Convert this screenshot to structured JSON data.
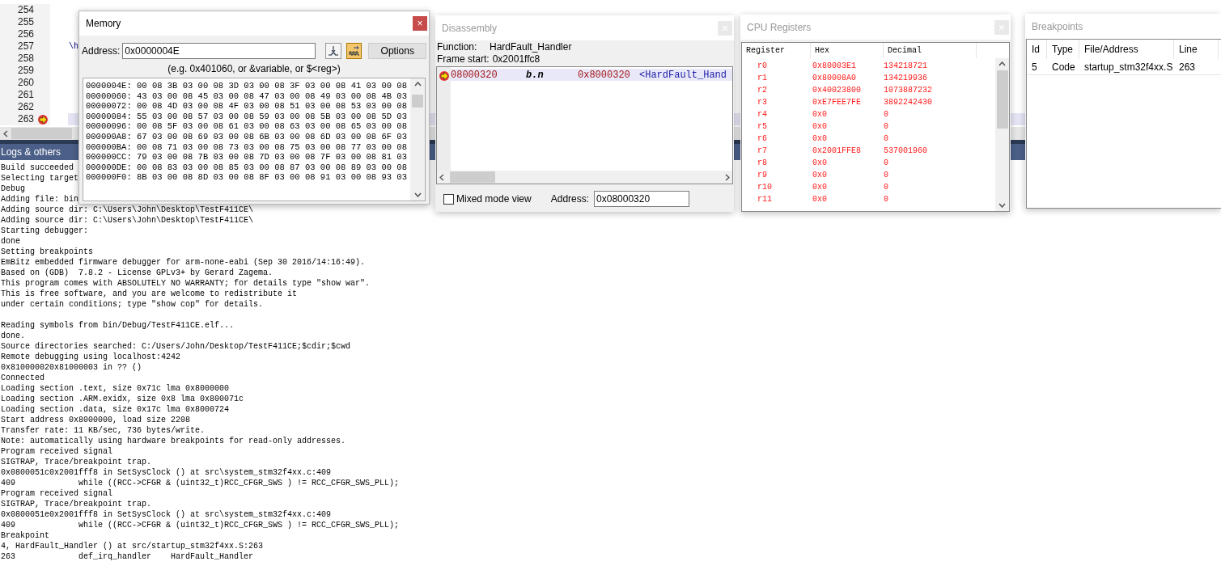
{
  "editor": {
    "lines": [
      {
        "number": "254",
        "current": false
      },
      {
        "number": "255",
        "current": false
      },
      {
        "number": "256",
        "current": false
      },
      {
        "number": "257",
        "code": "\\h",
        "current": false
      },
      {
        "number": "258",
        "current": false
      },
      {
        "number": "259",
        "current": false
      },
      {
        "number": "260",
        "current": false
      },
      {
        "number": "261",
        "current": false
      },
      {
        "number": "262",
        "current": false
      },
      {
        "number": "263",
        "current": true
      }
    ]
  },
  "logs": {
    "title": "Logs & others",
    "blocks": [
      [
        "Build succeeded",
        "Selecting target",
        "Debug",
        "Adding file: bin",
        "Adding source dir: C:\\Users\\John\\Desktop\\TestF411CE\\",
        "Adding source dir: C:\\Users\\John\\Desktop\\TestF411CE\\",
        "Starting debugger:",
        "done",
        "Setting breakpoints",
        "EmBitz embedded firmware debugger for arm-none-eabi (Sep 30 2016/14:16:49).",
        "Based on (GDB)  7.8.2 - License GPLv3+ by Gerard Zagema.",
        "This program comes with ABSOLUTELY NO WARRANTY; for details type \"show war\".",
        "This is free software, and you are welcome to redistribute it",
        "under certain conditions; type \"show cop\" for details."
      ],
      [
        "Reading symbols from bin/Debug/TestF411CE.elf...",
        "done.",
        "Source directories searched: C:/Users/John/Desktop/TestF411CE;$cdir;$cwd",
        "Remote debugging using localhost:4242",
        "0x810000020x81000003 in ?? ()",
        "Connected",
        "Loading section .text, size 0x71c lma 0x8000000",
        "Loading section .ARM.exidx, size 0x8 lma 0x800071c",
        "Loading section .data, size 0x17c lma 0x8000724",
        "Start address 0x8000000, load size 2208",
        "Transfer rate: 11 KB/sec, 736 bytes/write.",
        "Note: automatically using hardware breakpoints for read-only addresses.",
        "Program received signal",
        "SIGTRAP, Trace/breakpoint trap.",
        "0x0800051c0x2001fff8 in SetSysClock () at src\\system_stm32f4xx.c:409",
        "409\t        while ((RCC->CFGR & (uint32_t)RCC_CFGR_SWS ) != RCC_CFGR_SWS_PLL);",
        "Program received signal",
        "SIGTRAP, Trace/breakpoint trap.",
        "0x0800051e0x2001fff8 in SetSysClock () at src\\system_stm32f4xx.c:409",
        "409\t        while ((RCC->CFGR & (uint32_t)RCC_CFGR_SWS ) != RCC_CFGR_SWS_PLL);",
        "Breakpoint",
        "4, HardFault_Handler () at src/startup_stm32f4xx.S:263",
        "263\t        def_irq_handler    HardFault_Handler"
      ]
    ]
  },
  "memory": {
    "title": "Memory",
    "close": "×",
    "address_label": "Address:",
    "address_value": "0x0000004E",
    "options_button": "Options",
    "hint": "(e.g. 0x401060, or &variable, or $<reg>)",
    "rows": [
      "0000004E: 00 08 3B 03 00 08 3D 03 00 08 3F 03 00 08 41 03 00 08",
      "00000060: 43 03 00 08 45 03 00 08 47 03 00 08 49 03 00 08 4B 03",
      "00000072: 00 08 4D 03 00 08 4F 03 00 08 51 03 00 08 53 03 00 08",
      "00000084: 55 03 00 08 57 03 00 08 59 03 00 08 5B 03 00 08 5D 03",
      "00000096: 00 08 5F 03 00 08 61 03 00 08 63 03 00 08 65 03 00 08",
      "000000A8: 67 03 00 08 69 03 00 08 6B 03 00 08 6D 03 00 08 6F 03",
      "000000BA: 00 08 71 03 00 08 73 03 00 08 75 03 00 08 77 03 00 08",
      "000000CC: 79 03 00 08 7B 03 00 08 7D 03 00 08 7F 03 00 08 81 03",
      "000000DE: 00 08 83 03 00 08 85 03 00 08 87 03 00 08 89 03 00 08",
      "000000F0: 8B 03 00 08 8D 03 00 08 8F 03 00 08 91 03 00 08 93 03"
    ]
  },
  "disassembly": {
    "title": "Disassembly",
    "function_label": "Function:",
    "function_value": "HardFault_Handler",
    "frame_label": "Frame start:",
    "frame_value": "0x2001ffc8",
    "rows": [
      {
        "address": "08000320",
        "mnemonic": "b.n",
        "operand": "0x8000320",
        "symbol": "<HardFault_Hand",
        "current": true
      }
    ],
    "mixed_mode": {
      "label": "Mixed mode view",
      "checked": false
    },
    "address_label": "Address:",
    "address_value": "0x08000320"
  },
  "registers": {
    "title": "CPU Registers",
    "columns": [
      "Register",
      "Hex",
      "Decimal"
    ],
    "rows": [
      {
        "name": "r0",
        "hex": "0x80003E1",
        "decimal": "134218721",
        "changed": true
      },
      {
        "name": "r1",
        "hex": "0x80008A0",
        "decimal": "134219936",
        "changed": true
      },
      {
        "name": "r2",
        "hex": "0x40023800",
        "decimal": "1073887232",
        "changed": true
      },
      {
        "name": "r3",
        "hex": "0xE7FEE7FE",
        "decimal": "3892242430",
        "changed": true
      },
      {
        "name": "r4",
        "hex": "0x0",
        "decimal": "0",
        "changed": true
      },
      {
        "name": "r5",
        "hex": "0x0",
        "decimal": "0",
        "changed": true
      },
      {
        "name": "r6",
        "hex": "0x0",
        "decimal": "0",
        "changed": true
      },
      {
        "name": "r7",
        "hex": "0x2001FFE8",
        "decimal": "537001960",
        "changed": true
      },
      {
        "name": "r8",
        "hex": "0x0",
        "decimal": "0",
        "changed": true
      },
      {
        "name": "r9",
        "hex": "0x0",
        "decimal": "0",
        "changed": true
      },
      {
        "name": "r10",
        "hex": "0x0",
        "decimal": "0",
        "changed": true
      },
      {
        "name": "r11",
        "hex": "0x0",
        "decimal": "0",
        "changed": true
      }
    ]
  },
  "breakpoints": {
    "title": "Breakpoints",
    "columns": [
      "Id",
      "Type",
      "File/Address",
      "Line"
    ],
    "rows": [
      {
        "id": "5",
        "type": "Code",
        "file": "startup_stm32f4xx.S",
        "line": "263"
      }
    ]
  }
}
